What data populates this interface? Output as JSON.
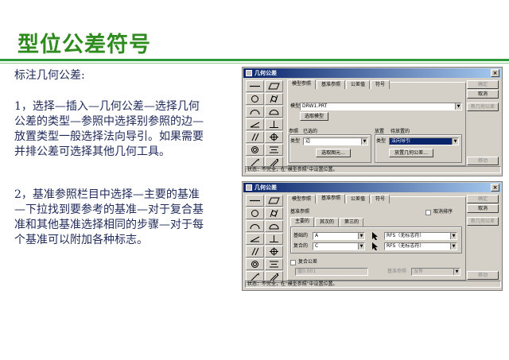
{
  "slide": {
    "title": "型位公差符号",
    "intro": "标注几何公差:",
    "para1": "1，选择—插入—几何公差—选择几何公差的类型—参照中选择别参照的边—放置类型一般选择法向导引。如果需要并排公差可选择其他几何工具。",
    "para2": "2，基准参照栏目中选择—主要的基准—下拉找到要参考的基准—对于复合基准和其他基准选择相同的步骤—对于每个基准可以附加各种标志。"
  },
  "dialog1": {
    "title": "几何公差",
    "close": "×",
    "tabs": [
      "模型参照",
      "基准参照",
      "公差值",
      "符号"
    ],
    "model_label": "模型",
    "model_value": "DRW1.PRT",
    "select_model": "选取模型",
    "ref_group": "参照",
    "ref_selected": "已选的",
    "ref_type_label": "类型",
    "ref_type_value": "边",
    "ref_select": "选取图元...",
    "place_group": "放置",
    "place_state": "待放置的",
    "place_type_label": "类型",
    "place_type_value": "法向导引",
    "place_button": "放置几何公差...",
    "side_buttons": [
      "确定",
      "取消",
      "新几何公差",
      "移动"
    ],
    "status": "状态：不完全，在\"模型参照\"中设置位置。"
  },
  "dialog2": {
    "title": "几何公差",
    "close": "×",
    "tabs": [
      "模型参照",
      "基准参照",
      "公差值",
      "符号"
    ],
    "datum_group": "基准参照",
    "cancel_sort": "取消排序",
    "subtabs": [
      "主要的",
      "其次的",
      "第三的"
    ],
    "basic_label": "基础的",
    "basic_value": "A",
    "compound_label": "复合的",
    "compound_value": "C",
    "mod1": "RFS（无标志符）",
    "mod2": "RFS（无标志符）",
    "composite_label": "复合公差",
    "composite_value": "值0.001",
    "datum_ref_label": "基准参照",
    "datum_ref_value": "没有",
    "side_buttons": [
      "确定",
      "取消",
      "新几何公差",
      "移动"
    ],
    "status": "状态：不完全，在\"模型参照\"中设置位置。"
  }
}
